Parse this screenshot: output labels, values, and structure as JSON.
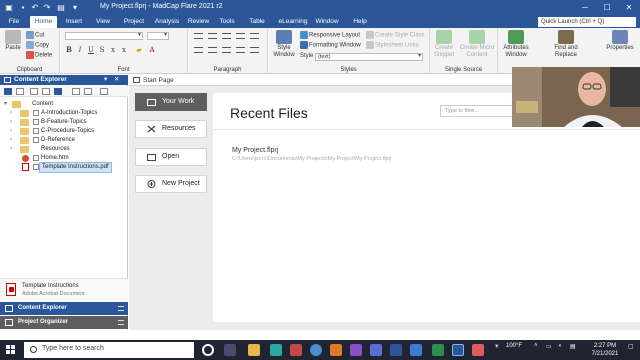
{
  "app": {
    "title": "My Project.flprj - MadCap Flare 2021 r2",
    "window_controls": [
      "─",
      "☐",
      "✕"
    ]
  },
  "menu": {
    "items": [
      "File",
      "Home",
      "Insert",
      "View",
      "Project",
      "Analysis",
      "Review",
      "Tools",
      "Table",
      "eLearning",
      "Window",
      "Help"
    ],
    "active": "Home",
    "quick_launch": "Quick Launch (Ctrl + Q)"
  },
  "ribbon": {
    "clipboard": {
      "label": "Clipboard",
      "paste": "Paste",
      "cut": "Cut",
      "copy": "Copy",
      "delete": "Delete"
    },
    "font": {
      "label": "Font"
    },
    "paragraph": {
      "label": "Paragraph"
    },
    "styles": {
      "label": "Styles",
      "style_window": "Style Window",
      "responsive_layout": "Responsive Layout",
      "formatting_window": "Formatting Window",
      "style_label": "Style",
      "style_value": "(text)",
      "create_style_class": "Create Style Class",
      "stylesheet_links": "Stylesheet Links"
    },
    "single_source": {
      "label": "Single Source",
      "create_snippet": "Create Snippet",
      "create_micro_content": "Create Micro Content"
    },
    "attributes_window": "Attributes Window",
    "find_replace": "Find and Replace",
    "properties": "Properties"
  },
  "content_explorer": {
    "header": "Content Explorer",
    "tree": [
      {
        "label": "Content",
        "type": "root"
      },
      {
        "label": "A-Introduction-Topics",
        "type": "folder"
      },
      {
        "label": "B-Feature-Topics",
        "type": "folder"
      },
      {
        "label": "C-Procedure-Topics",
        "type": "folder"
      },
      {
        "label": "D-Reference",
        "type": "folder"
      },
      {
        "label": "Resources",
        "type": "folder"
      },
      {
        "label": "Home.htm",
        "type": "html"
      },
      {
        "label": "Template Instructions.pdf",
        "type": "pdf"
      }
    ],
    "preview_title": "Template Instructions",
    "preview_subtitle": "Adobe Acrobat Document",
    "tabs": [
      "Content Explorer",
      "Project Organizer"
    ]
  },
  "start_page": {
    "tab_label": "Start Page",
    "nav": [
      "Your Work",
      "Resources",
      "Open",
      "New Project"
    ],
    "active_nav": "Your Work",
    "recent_title": "Recent Files",
    "filter_placeholder": "Type to filter...",
    "recent_files": [
      {
        "name": "My Project.flprj",
        "path": "C:\\Users\\jscro\\Documents\\My Projects\\My Project\\My Project.flprj"
      }
    ]
  },
  "taskbar": {
    "search_placeholder": "Type here to search",
    "weather": "100°F",
    "time": "2:27 PM",
    "date": "7/21/2021"
  },
  "colors": {
    "brand_blue": "#2b579a",
    "taskbar": "#1f2430",
    "nav_active": "#5f5f5f"
  }
}
